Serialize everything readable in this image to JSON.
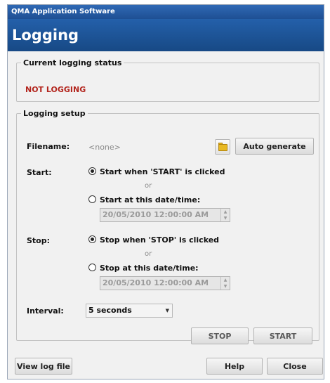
{
  "window": {
    "title": "QMA Application Software",
    "header": "Logging"
  },
  "status": {
    "legend": "Current logging status",
    "value": "NOT LOGGING",
    "value_color": "#b3261e"
  },
  "setup": {
    "legend": "Logging setup",
    "filename": {
      "label": "Filename:",
      "value": "<none>",
      "folder_icon": "folder-icon",
      "auto_generate_label": "Auto generate"
    },
    "start": {
      "label": "Start:",
      "option_click": "Start when 'START' is clicked",
      "or": "or",
      "option_datetime": "Start at this date/time:",
      "datetime_value": "20/05/2010  12:00:00  AM",
      "selected": "click"
    },
    "stop": {
      "label": "Stop:",
      "option_click": "Stop when 'STOP' is clicked",
      "or": "or",
      "option_datetime": "Stop at this date/time:",
      "datetime_value": "20/05/2010  12:00:00  AM",
      "selected": "click"
    },
    "interval": {
      "label": "Interval:",
      "value": "5 seconds"
    },
    "stop_button": "STOP",
    "start_button": "START"
  },
  "footer": {
    "view_log_label": "View log file",
    "help_label": "Help",
    "close_label": "Close"
  },
  "colors": {
    "header_blue": "#1e5aa0",
    "status_red": "#b3261e"
  }
}
